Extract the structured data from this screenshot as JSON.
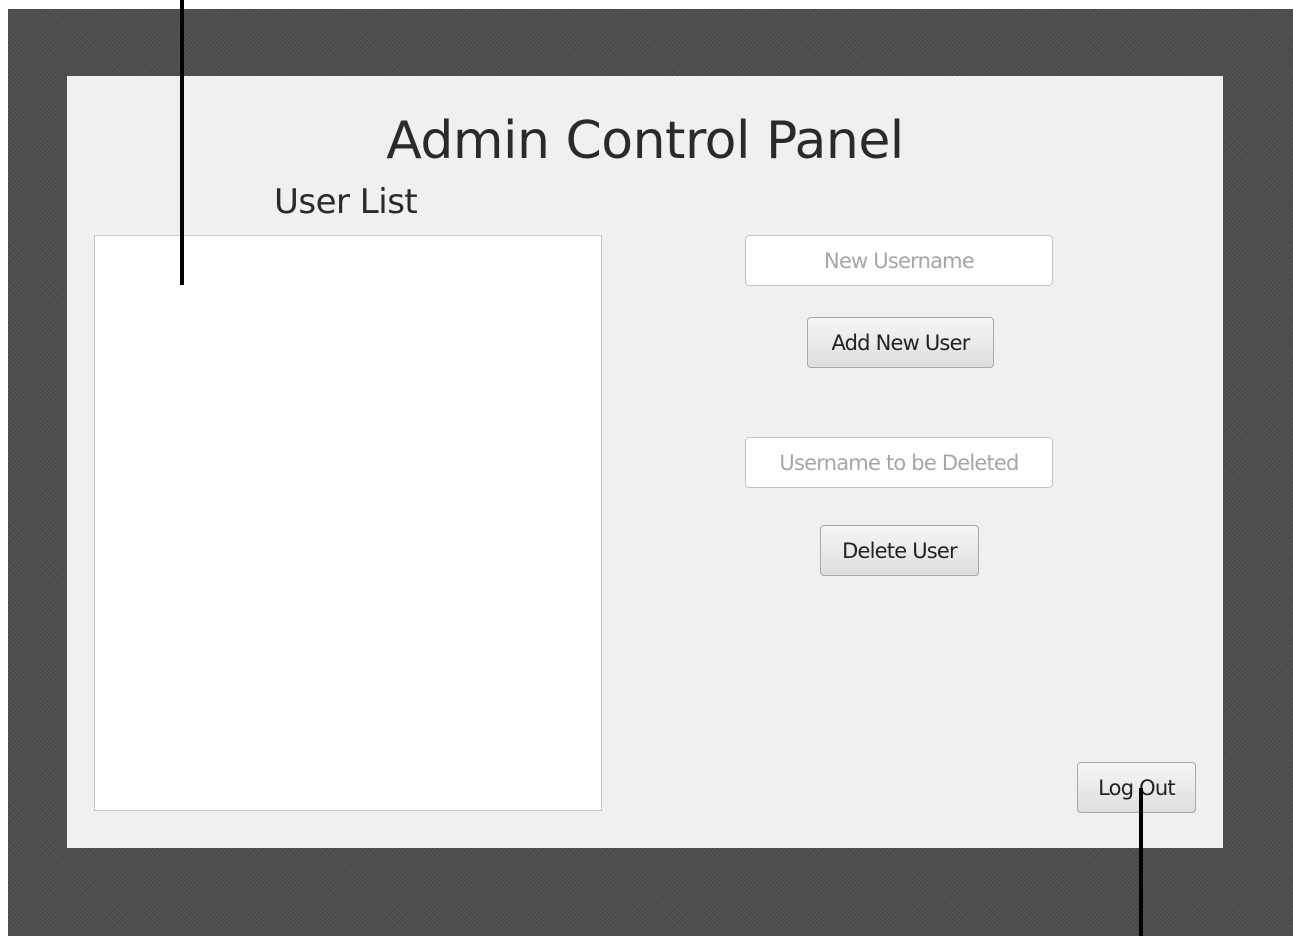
{
  "window": {
    "title": "Admin Control Panel",
    "background": "#f0f0f0"
  },
  "user_list": {
    "label": "User List",
    "items": []
  },
  "add_user": {
    "placeholder": "New Username",
    "value": "",
    "button_label": "Add New User"
  },
  "delete_user": {
    "placeholder": "Username to be Deleted",
    "value": "",
    "button_label": "Delete User"
  },
  "logout": {
    "button_label": "Log Out"
  },
  "colors": {
    "backdrop": "#4d4d4d",
    "panel": "#f0f0f0",
    "text": "#2a2a2a"
  }
}
